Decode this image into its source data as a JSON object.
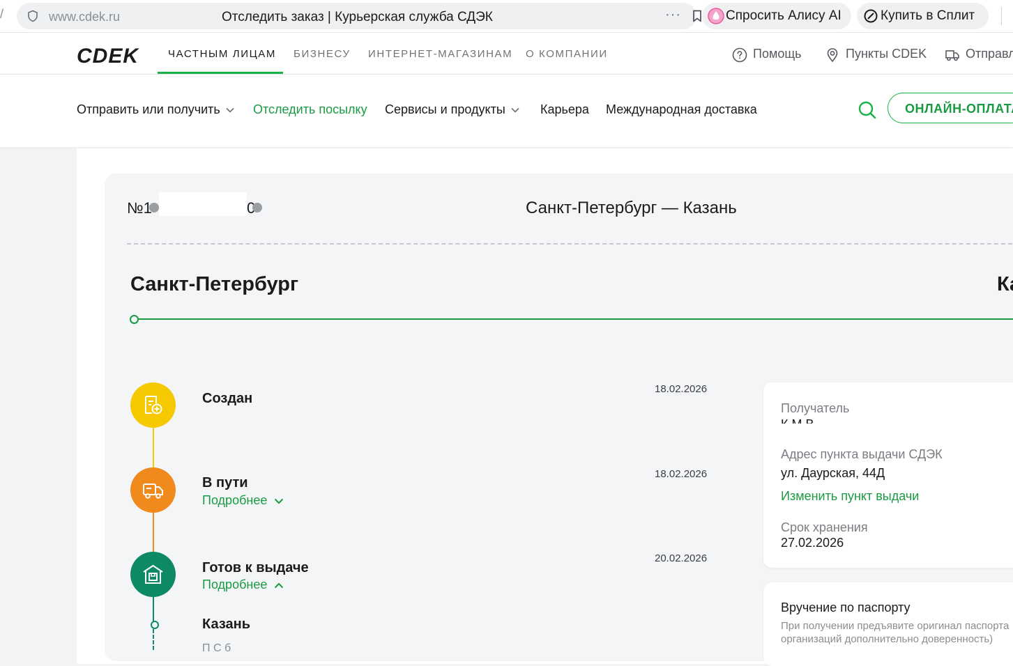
{
  "browser": {
    "url": "www.cdek.ru",
    "page_title": "Отследить заказ | Курьерская служба СДЭК",
    "more_glyph": "···",
    "alice_label": "Спросить Алису AI",
    "split_label": "Купить в Сплит",
    "left_edge_glyph": "/"
  },
  "site_nav": {
    "logo": "CDEK",
    "segments": [
      "ЧАСТНЫМ ЛИЦАМ",
      "БИЗНЕСУ",
      "ИНТЕРНЕТ-МАГАЗИНАМ",
      "О КОМПАНИИ"
    ],
    "help": "Помощь",
    "points": "Пункты CDEK",
    "send": "Отправл"
  },
  "menu": {
    "send_receive": "Отправить или получить",
    "track": "Отследить посылку",
    "services": "Сервисы и продукты",
    "career": "Карьера",
    "international": "Международная доставка",
    "online_pay": "ОНЛАЙН-ОПЛАТА"
  },
  "order": {
    "number_prefix": "№",
    "number_visible_start": "1",
    "number_visible_end": "0",
    "route": "Санкт-Петербург — Казань",
    "city_from": "Санкт-Петербург",
    "city_to": "Ка"
  },
  "statuses": [
    {
      "title": "Создан",
      "date": "18.02.2026",
      "more": ""
    },
    {
      "title": "В пути",
      "date": "18.02.2026",
      "more": "Подробнее"
    },
    {
      "title": "Готов к выдаче",
      "date": "20.02.2026",
      "more": "Подробнее"
    }
  ],
  "status_detail": {
    "city": "Казань",
    "cut_text": "П       С  б"
  },
  "recipient_card": {
    "recipient_label": "Получатель",
    "recipient_value": "К.М.В.",
    "address_label": "Адрес пункта выдачи СДЭК",
    "address_value": "ул. Даурская, 44Д",
    "change_link": "Изменить пункт выдачи",
    "storage_label": "Срок хранения",
    "storage_value": "27.02.2026"
  },
  "passport_card": {
    "title": "Вручение по паспорту",
    "line1": "При получении предъявите оригинал паспорта",
    "line2": "организаций дополнительно доверенность)"
  },
  "colors": {
    "green": "#1ab248",
    "yellow": "#f5c800",
    "orange": "#f08a1c",
    "teal": "#0d8a64"
  }
}
